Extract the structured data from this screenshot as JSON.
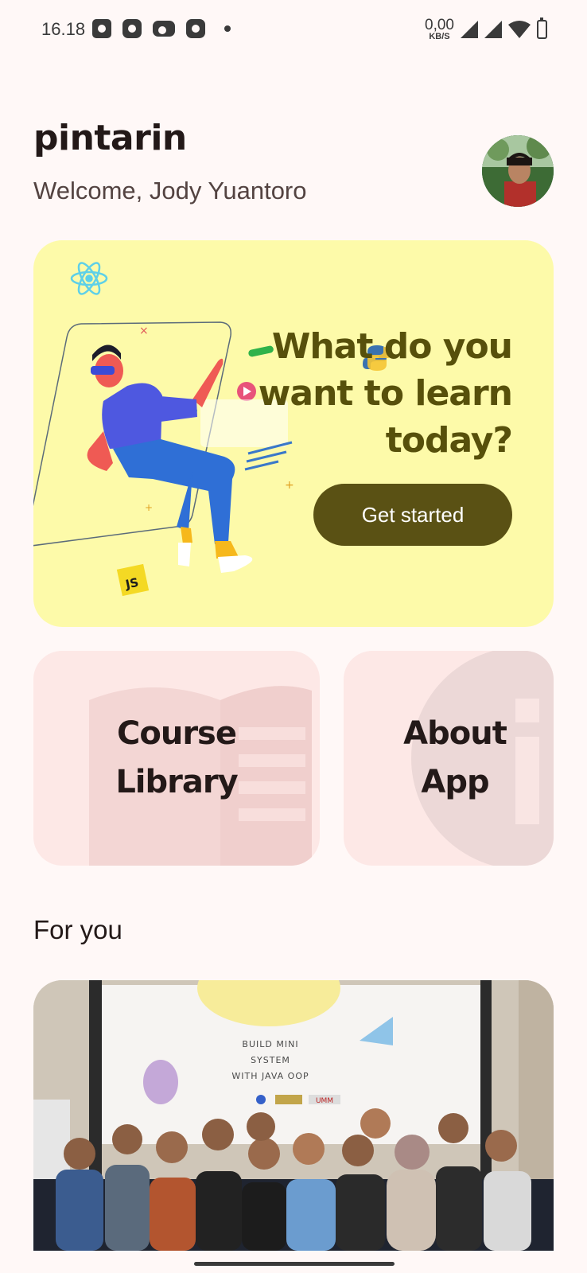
{
  "status_bar": {
    "time": "16.18",
    "net_speed_value": "0,00",
    "net_speed_unit": "KB/S",
    "icons": [
      "shopee-icon",
      "instagram-icon",
      "youtube-icon",
      "tokopedia-icon",
      "notification-dot",
      "signal-icon",
      "signal-icon",
      "wifi-icon",
      "battery-charging-icon"
    ]
  },
  "header": {
    "app_title": "pintarin",
    "welcome": "Welcome, Jody Yuantoro"
  },
  "hero": {
    "title_line1": "What do you",
    "title_line2": "want to learn",
    "title_line3": "today?",
    "button_label": "Get started",
    "js_badge": "JS",
    "colors": {
      "background": "#fdfaa9",
      "title": "#57500b",
      "button": "#5a5114"
    }
  },
  "tiles": {
    "course_line1": "Course",
    "course_line2": "Library",
    "about_line1": "About",
    "about_line2": "App",
    "color": "#fde8e6"
  },
  "for_you": {
    "title": "For you",
    "banner_line1": "BUILD MINI",
    "banner_line2": "SYSTEM",
    "banner_line3": "WITH JAVA OOP",
    "banner_logo": "UMM"
  }
}
